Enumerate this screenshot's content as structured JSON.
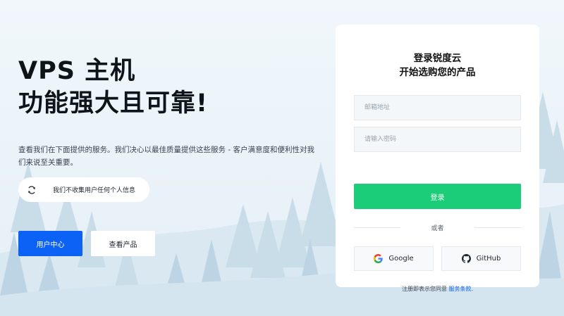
{
  "hero": {
    "headline_line1": "VPS 主机",
    "headline_line2": "功能强大且可靠!",
    "description": "查看我们在下面提供的服务。我们决心以最佳质量提供这些服务 - 客户满意度和便利性对我们来说至关重要。",
    "privacy_note": "我们不收集用户任何个人信息",
    "user_center_label": "用户中心",
    "view_products_label": "查看产品"
  },
  "login": {
    "title_line1": "登录锐度云",
    "title_line2": "开始选购您的产品",
    "email_placeholder": "邮箱地址",
    "password_placeholder": "请输入密码",
    "submit_label": "登录",
    "or_label": "或者",
    "google_label": "Google",
    "github_label": "GitHub",
    "terms_prefix": "注册即表示您同意",
    "terms_link": "服务条款",
    "terms_suffix": "."
  },
  "colors": {
    "background": "#e9f3f9",
    "primary": "#0b62f5",
    "login_green": "#1bcc78",
    "tree": "#c7dde9"
  },
  "icons": {
    "privacy": "refresh-shield-icon",
    "google": "google-icon",
    "github": "github-icon"
  }
}
